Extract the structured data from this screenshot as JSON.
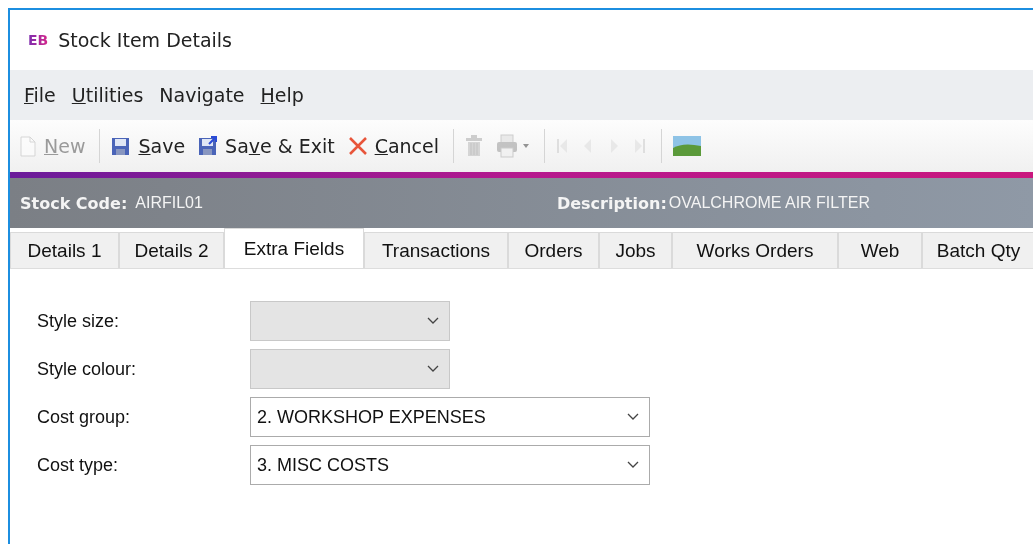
{
  "window": {
    "logo": "EB",
    "title": "Stock Item Details"
  },
  "menu": [
    {
      "key": "F",
      "after": "ile"
    },
    {
      "key": "U",
      "after": "tilities"
    },
    {
      "before": "Navigate"
    },
    {
      "key": "H",
      "after": "elp"
    }
  ],
  "toolbar": [
    {
      "kind": "new",
      "key": "N",
      "after": "ew",
      "disabled": true
    },
    {
      "kind": "sep"
    },
    {
      "kind": "save",
      "key": "S",
      "after": "ave",
      "disabled": false
    },
    {
      "kind": "saveexit",
      "before": "Sa",
      "key": "v",
      "after": "e & Exit",
      "disabled": false
    },
    {
      "kind": "cancel",
      "key": "C",
      "after": "ancel",
      "disabled": false
    },
    {
      "kind": "sep"
    },
    {
      "kind": "delete",
      "disabled": true
    },
    {
      "kind": "print",
      "disabled": true
    },
    {
      "kind": "sep"
    },
    {
      "kind": "first",
      "disabled": true
    },
    {
      "kind": "prev",
      "disabled": true
    },
    {
      "kind": "next",
      "disabled": true
    },
    {
      "kind": "last",
      "disabled": true
    },
    {
      "kind": "sep"
    },
    {
      "kind": "image",
      "disabled": false
    }
  ],
  "header": {
    "code_label": "Stock Code:",
    "code": "AIRFIL01",
    "desc_label": "Description:",
    "desc": "OVALCHROME AIR FILTER"
  },
  "tabs": [
    {
      "label": "Details 1",
      "selected": false
    },
    {
      "label": "Details 2",
      "selected": false
    },
    {
      "label": "Extra Fields",
      "selected": true
    },
    {
      "label": "Transactions",
      "selected": false
    },
    {
      "label": "Orders",
      "selected": false
    },
    {
      "label": "Jobs",
      "selected": false
    },
    {
      "label": "Works Orders",
      "selected": false
    },
    {
      "label": "Web",
      "selected": false
    },
    {
      "label": "Batch Qty",
      "selected": false
    }
  ],
  "fields": [
    {
      "label": "Style size:",
      "disabled": true
    },
    {
      "label": "Style colour:",
      "disabled": true
    },
    {
      "label": "Cost group:",
      "value": "2. WORKSHOP EXPENSES",
      "disabled": false
    },
    {
      "label": "Cost type:",
      "value": "3. MISC COSTS",
      "disabled": false
    }
  ]
}
